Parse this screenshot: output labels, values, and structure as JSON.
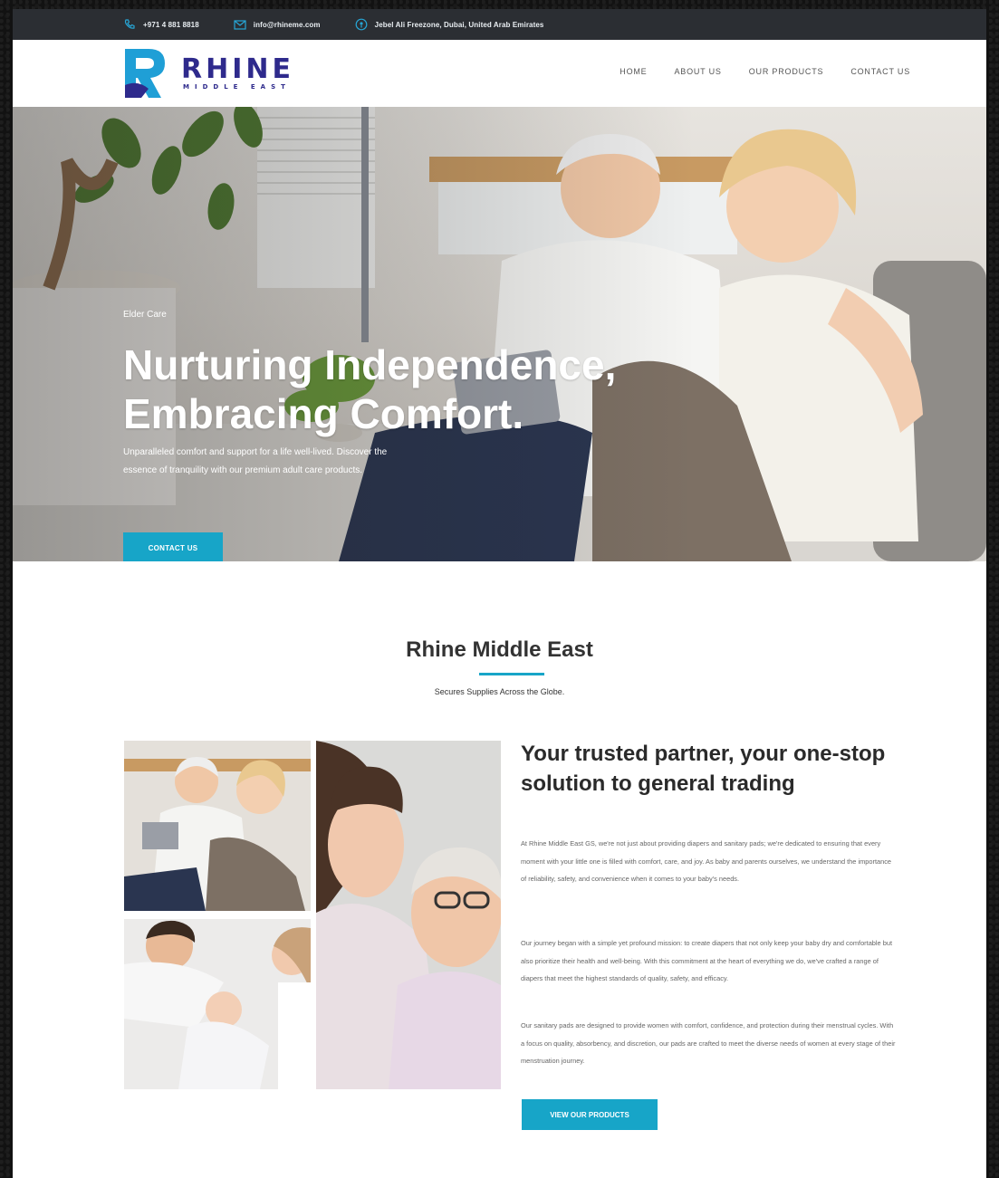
{
  "topbar": {
    "phone": "+971 4 881 8818",
    "email": "info@rhineme.com",
    "address": "Jebel Ali Freezone, Dubai, United Arab Emirates"
  },
  "logo": {
    "name": "RHINE",
    "subtitle": "MIDDLE EAST"
  },
  "nav": {
    "items": [
      "HOME",
      "ABOUT US",
      "OUR PRODUCTS",
      "CONTACT US"
    ]
  },
  "hero": {
    "eyebrow": "Elder Care",
    "title": "Nurturing Independence, Embracing Comfort.",
    "text": "Unparalleled comfort and support for a life well-lived. Discover the essence of tranquility with our premium adult care products.",
    "button": "CONTACT US"
  },
  "about": {
    "title": "Rhine Middle East",
    "subtitle": "Secures Supplies Across the Globe.",
    "heading": "Your trusted partner, your one-stop solution to general trading",
    "paragraphs": [
      "At Rhine Middle East GS, we're not just about providing diapers and sanitary pads; we're dedicated to ensuring that every moment with your little one is filled with comfort, care, and joy. As baby and parents ourselves, we understand the importance of reliability, safety, and convenience when it comes to your baby's needs.",
      "Our journey began with a simple yet profound mission: to create diapers that not only keep your baby dry and comfortable but also prioritize their health and well-being. With this commitment at the heart of everything we do, we've crafted a range of diapers that meet the highest standards of quality, safety, and efficacy.",
      "Our sanitary pads are designed to provide women with comfort, confidence, and protection during their menstrual cycles. With a focus on quality, absorbency, and discretion, our pads are crafted to meet the diverse needs of women at every stage of their menstruation journey."
    ],
    "button": "VIEW OUR PRODUCTS"
  },
  "colors": {
    "accent": "#17a5c8",
    "brand": "#2e2a8c",
    "topbar": "#2b2e33"
  },
  "icons": [
    "phone-icon",
    "mail-icon",
    "location-icon"
  ]
}
